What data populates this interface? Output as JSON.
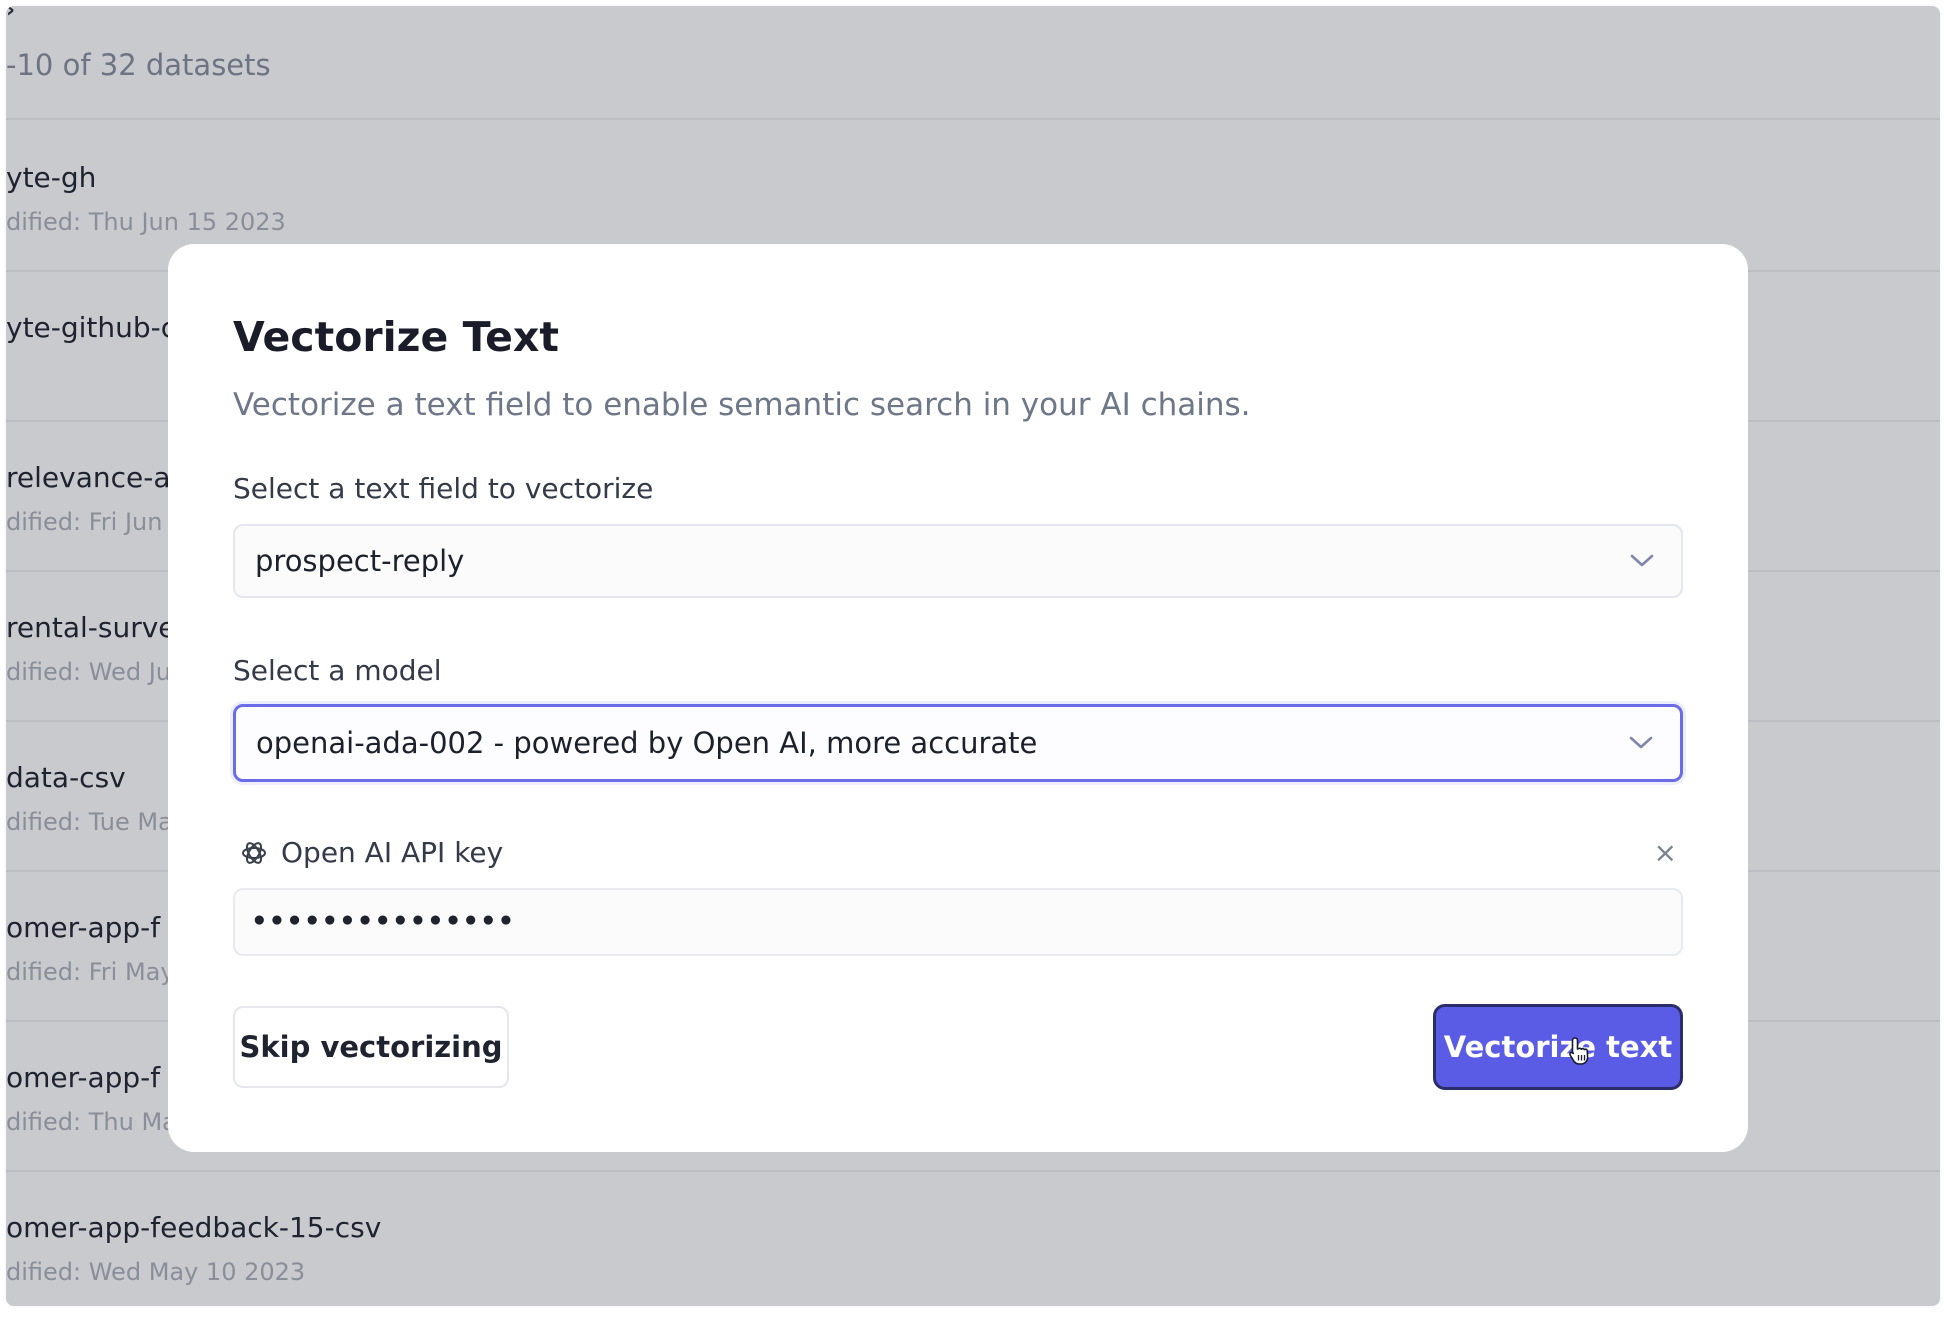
{
  "background": {
    "caret": "›",
    "count_text": "-10 of 32 datasets",
    "datasets": [
      {
        "name": "yte-gh",
        "modified": "dified: Thu Jun 15 2023"
      },
      {
        "name": "yte-github-c",
        "modified": ""
      },
      {
        "name": "relevance-a",
        "modified": "dified: Fri Jun :"
      },
      {
        "name": "rental-surve",
        "modified": "dified: Wed Ju"
      },
      {
        "name": "data-csv",
        "modified": "dified: Tue Ma"
      },
      {
        "name": "omer-app-f",
        "modified": "dified: Fri May"
      },
      {
        "name": "omer-app-f",
        "modified": "dified: Thu Ma"
      },
      {
        "name": "omer-app-feedback-15-csv",
        "modified": "dified: Wed May 10 2023"
      }
    ]
  },
  "modal": {
    "title": "Vectorize Text",
    "subtitle": "Vectorize a text field to enable semantic search in your AI chains.",
    "text_field": {
      "label": "Select a text field to vectorize",
      "value": "prospect-reply"
    },
    "model": {
      "label": "Select a model",
      "value": "openai-ada-002 - powered by Open AI, more accurate"
    },
    "api_key": {
      "label": "Open AI API key",
      "value": "•••••••••••••••",
      "close": "×"
    },
    "buttons": {
      "skip": "Skip vectorizing",
      "vectorize": "Vectorize text"
    }
  },
  "colors": {
    "overlay": "#c9cace",
    "accent": "#5b5ce6",
    "focus_border": "#6b6de8"
  },
  "icons": {
    "chevron": "chevron-down-icon",
    "openai": "openai-logo-icon",
    "close": "close-icon",
    "cursor": "hand-pointer-icon"
  }
}
